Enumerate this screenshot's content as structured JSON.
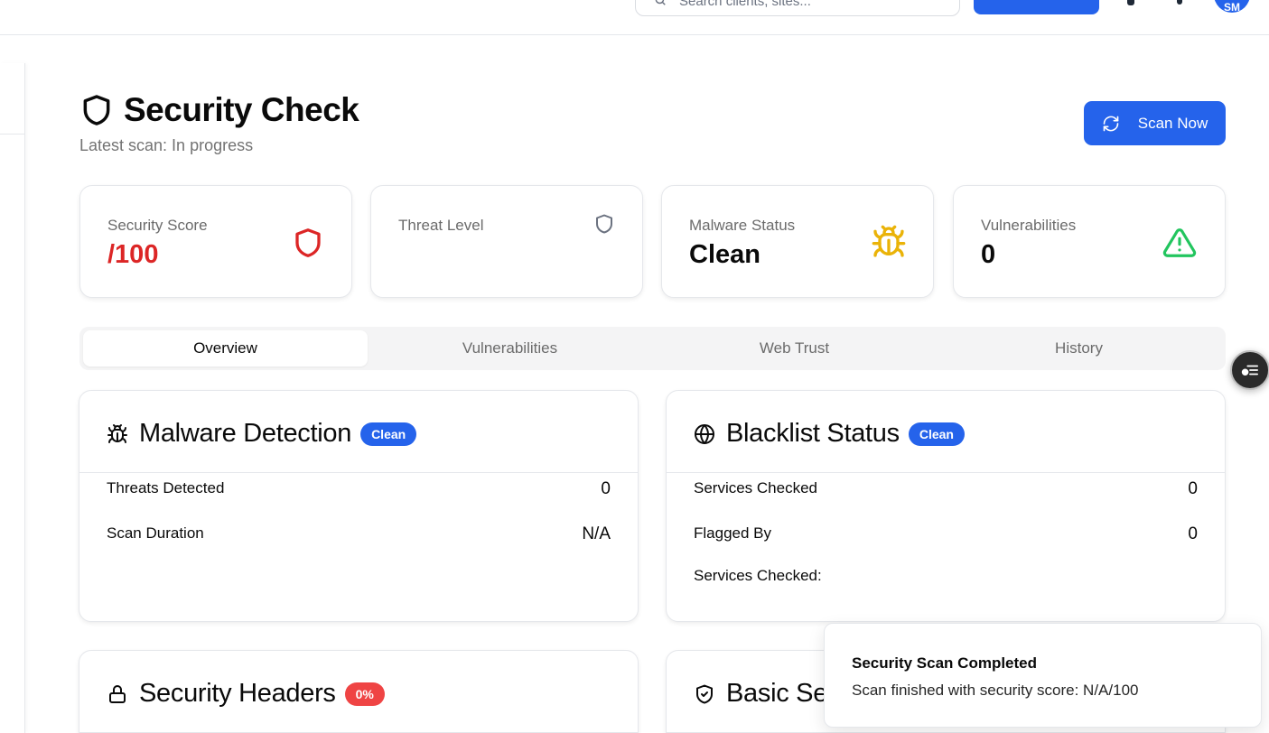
{
  "topbar": {
    "search_placeholder": "Search clients, sites...",
    "avatar_initials": "SM"
  },
  "header": {
    "title": "Security Check",
    "subtitle": "Latest scan: In progress",
    "scan_button": "Scan Now"
  },
  "stats": [
    {
      "label": "Security Score",
      "value": "/100",
      "icon": "shield-icon",
      "color": "#dc2626"
    },
    {
      "label": "Threat Level",
      "value": "",
      "icon": "shield-icon",
      "color": "#6b7280"
    },
    {
      "label": "Malware Status",
      "value": "Clean",
      "icon": "bug-icon",
      "color": "#eab308"
    },
    {
      "label": "Vulnerabilities",
      "value": "0",
      "icon": "warning-triangle-icon",
      "color": "#22c55e"
    }
  ],
  "tabs": [
    {
      "label": "Overview",
      "active": true
    },
    {
      "label": "Vulnerabilities",
      "active": false
    },
    {
      "label": "Web Trust",
      "active": false
    },
    {
      "label": "History",
      "active": false
    }
  ],
  "malware": {
    "title": "Malware Detection",
    "badge": "Clean",
    "rows": [
      {
        "label": "Threats Detected",
        "value": "0"
      },
      {
        "label": "Scan Duration",
        "value": "N/A"
      }
    ]
  },
  "blacklist": {
    "title": "Blacklist Status",
    "badge": "Clean",
    "rows": [
      {
        "label": "Services Checked",
        "value": "0"
      },
      {
        "label": "Flagged By",
        "value": "0"
      }
    ],
    "services_label": "Services Checked:"
  },
  "headers": {
    "title": "Security Headers",
    "badge": "0%"
  },
  "basic": {
    "title": "Basic Security"
  },
  "toast": {
    "title": "Security Scan Completed",
    "message": "Scan finished with security score: N/A/100"
  },
  "colors": {
    "primary": "#2563eb",
    "danger": "#ef4444",
    "score_red": "#dc2626",
    "bug_yellow": "#eab308",
    "ok_green": "#22c55e"
  }
}
